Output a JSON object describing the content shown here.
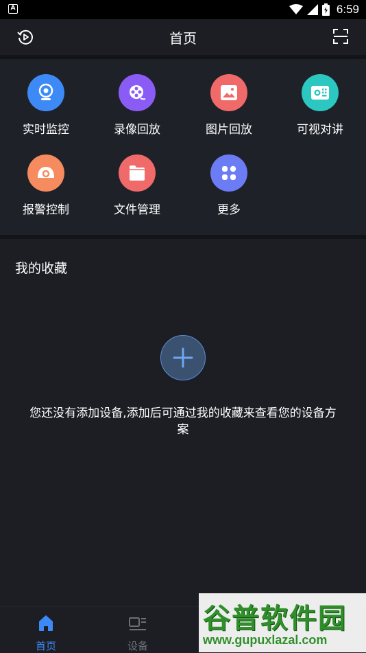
{
  "status_bar": {
    "time": "6:59",
    "left_icon_letter": "A"
  },
  "header": {
    "title": "首页",
    "left_icon": "history-play-icon",
    "right_icon": "scan-icon"
  },
  "grid": {
    "items": [
      {
        "label": "实时监控",
        "icon": "camera-icon",
        "color": "#3d8af7"
      },
      {
        "label": "录像回放",
        "icon": "film-reel-icon",
        "color": "#8a5cf5"
      },
      {
        "label": "图片回放",
        "icon": "image-icon",
        "color": "#f06a6a"
      },
      {
        "label": "可视对讲",
        "icon": "intercom-icon",
        "color": "#2bc7c0"
      },
      {
        "label": "报警控制",
        "icon": "alarm-icon",
        "color": "#f58b5e"
      },
      {
        "label": "文件管理",
        "icon": "folder-icon",
        "color": "#f06a6a"
      },
      {
        "label": "更多",
        "icon": "more-grid-icon",
        "color": "#6b7cf5"
      }
    ]
  },
  "favorites": {
    "title": "我的收藏",
    "empty_message": "您还没有添加设备,添加后可通过我的收藏来查看您的设备方案",
    "add_icon": "plus-icon"
  },
  "tabbar": {
    "tabs": [
      {
        "label": "首页",
        "icon": "home-icon",
        "active": true
      },
      {
        "label": "设备",
        "icon": "device-icon",
        "active": false
      }
    ]
  },
  "watermark": {
    "title": "谷普软件园",
    "url": "www.gupuxlazal.com"
  },
  "colors": {
    "background": "#1c1e24",
    "accent": "#3d8af7"
  }
}
